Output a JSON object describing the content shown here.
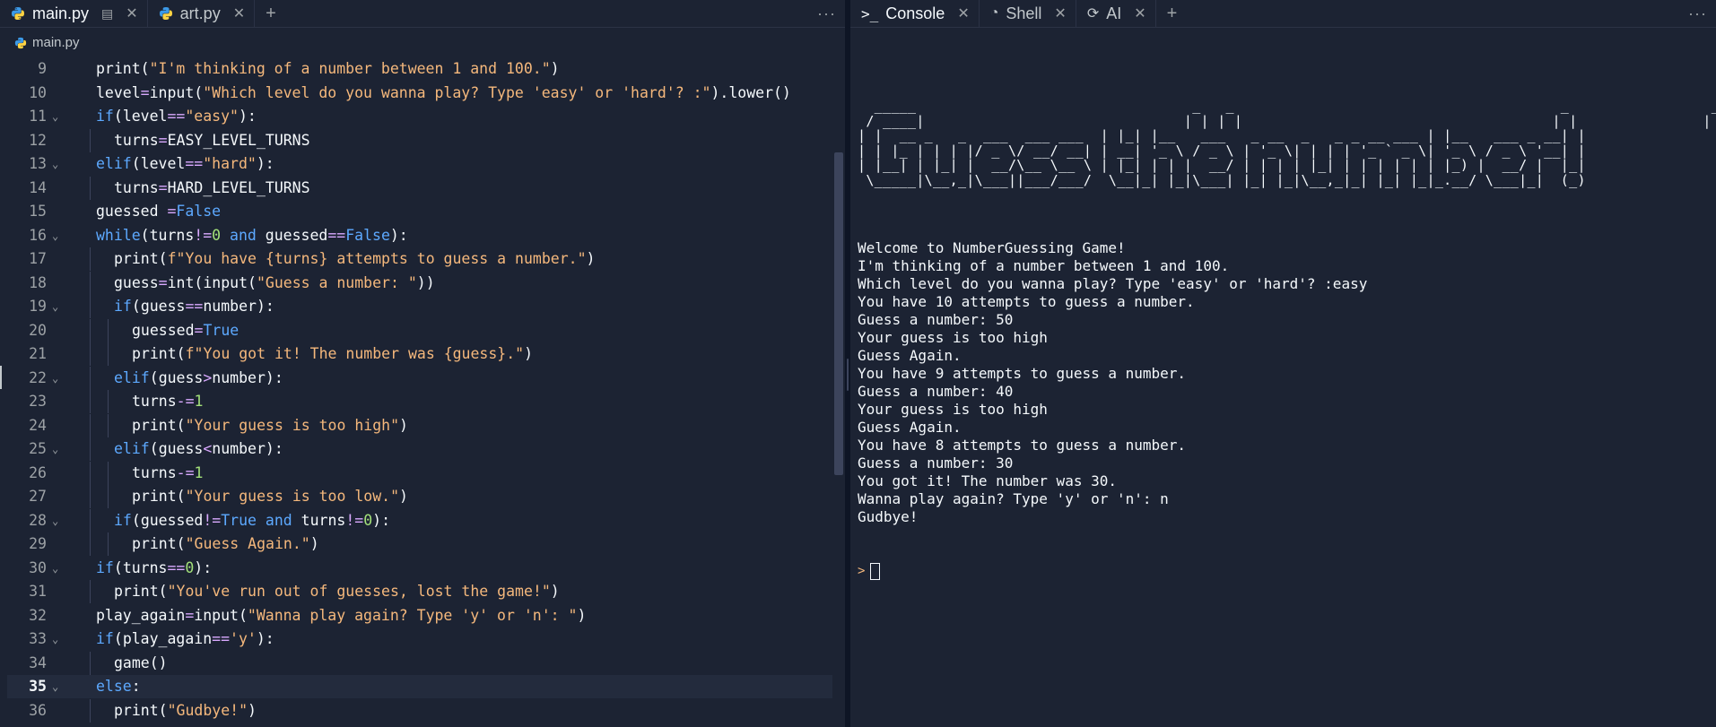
{
  "editor": {
    "tabs": [
      {
        "label": "main.py",
        "active": true
      },
      {
        "label": "art.py",
        "active": false
      }
    ],
    "breadcrumb": "main.py",
    "current_line": 35,
    "lines": [
      {
        "n": 9,
        "fold": false
      },
      {
        "n": 10,
        "fold": false
      },
      {
        "n": 11,
        "fold": true
      },
      {
        "n": 12,
        "fold": false
      },
      {
        "n": 13,
        "fold": true
      },
      {
        "n": 14,
        "fold": false
      },
      {
        "n": 15,
        "fold": false
      },
      {
        "n": 16,
        "fold": true
      },
      {
        "n": 17,
        "fold": false
      },
      {
        "n": 18,
        "fold": false
      },
      {
        "n": 19,
        "fold": true
      },
      {
        "n": 20,
        "fold": false
      },
      {
        "n": 21,
        "fold": false
      },
      {
        "n": 22,
        "fold": true
      },
      {
        "n": 23,
        "fold": false
      },
      {
        "n": 24,
        "fold": false
      },
      {
        "n": 25,
        "fold": true
      },
      {
        "n": 26,
        "fold": false
      },
      {
        "n": 27,
        "fold": false
      },
      {
        "n": 28,
        "fold": true
      },
      {
        "n": 29,
        "fold": false
      },
      {
        "n": 30,
        "fold": true
      },
      {
        "n": 31,
        "fold": false
      },
      {
        "n": 32,
        "fold": false
      },
      {
        "n": 33,
        "fold": true
      },
      {
        "n": 34,
        "fold": false
      },
      {
        "n": 35,
        "fold": true
      },
      {
        "n": 36,
        "fold": false
      }
    ],
    "code": [
      "print(\"I'm thinking of a number between 1 and 100.\")",
      "level=input(\"Which level do you wanna play? Type 'easy' or 'hard'? :\").lower()",
      "if(level==\"easy\"):",
      "  turns=EASY_LEVEL_TURNS",
      "elif(level==\"hard\"):",
      "  turns=HARD_LEVEL_TURNS",
      "guessed =False",
      "while(turns!=0 and guessed==False):",
      "  print(f\"You have {turns} attempts to guess a number.\")",
      "  guess=int(input(\"Guess a number: \"))",
      "  if(guess==number):",
      "    guessed=True",
      "    print(f\"You got it! The number was {guess}.\")",
      "  elif(guess>number):",
      "    turns-=1",
      "    print(\"Your guess is too high\")",
      "  elif(guess<number):",
      "    turns-=1",
      "    print(\"Your guess is too low.\")",
      "  if(guessed!=True and turns!=0):",
      "    print(\"Guess Again.\")",
      "if(turns==0):",
      "  print(\"You've run out of guesses, lost the game!\")",
      "play_again=input(\"Wanna play again? Type 'y' or 'n': \")",
      "if(play_again=='y'):",
      "  game()",
      "else:",
      "  print(\"Gudbye!\")"
    ]
  },
  "console_panel": {
    "tabs": [
      {
        "label": "Console",
        "active": true,
        "icon": "terminal-icon"
      },
      {
        "label": "Shell",
        "active": false,
        "icon": "shell-icon"
      },
      {
        "label": "AI",
        "active": false,
        "icon": "ai-icon"
      }
    ],
    "ascii_art": "  _____                                 _   _                                       _                 _ \n / ____|                               | | | |                                     | |               | |\n| |  __ _   _  ___  ___ ___  | |_| |__   ___   _ __  _   _ _ __ ___ | |__   ___ _ __| |\n| | |_ | | | |/ _ \\/ __/ __| | __| '_ \\ / _ \\ | '_ \\| | | | '_ ` _ \\| '_ \\ / _ \\ '__| |\n| |__| | |_| |  __/\\__ \\__ \\ | |_| | | |  __/ | | | | |_| | | | | | | |_) |  __/ |  |_|\n \\_____|\\__,_|\\___||___/___/  \\__|_| |_|\\___| |_| |_|\\__,_|_| |_| |_|_.__/ \\___|_|  (_)",
    "output": [
      "Welcome to NumberGuessing Game!",
      "I'm thinking of a number between 1 and 100.",
      "Which level do you wanna play? Type 'easy' or 'hard'? :easy",
      "You have 10 attempts to guess a number.",
      "Guess a number: 50",
      "Your guess is too high",
      "Guess Again.",
      "You have 9 attempts to guess a number.",
      "Guess a number: 40",
      "Your guess is too high",
      "Guess Again.",
      "You have 8 attempts to guess a number.",
      "Guess a number: 30",
      "You got it! The number was 30.",
      "Wanna play again? Type 'y' or 'n': n",
      "Gudbye!"
    ],
    "prompt_symbol": ">"
  },
  "icons": {
    "python": "python-icon",
    "more": "more-horizontal-icon",
    "add": "plus-icon",
    "close": "close-icon",
    "preview": "preview-icon"
  },
  "colors": {
    "background": "#1c2333",
    "keyword": "#5da9ff",
    "string": "#f5b87c",
    "number": "#a3e07a",
    "operator": "#d9a9ff"
  }
}
